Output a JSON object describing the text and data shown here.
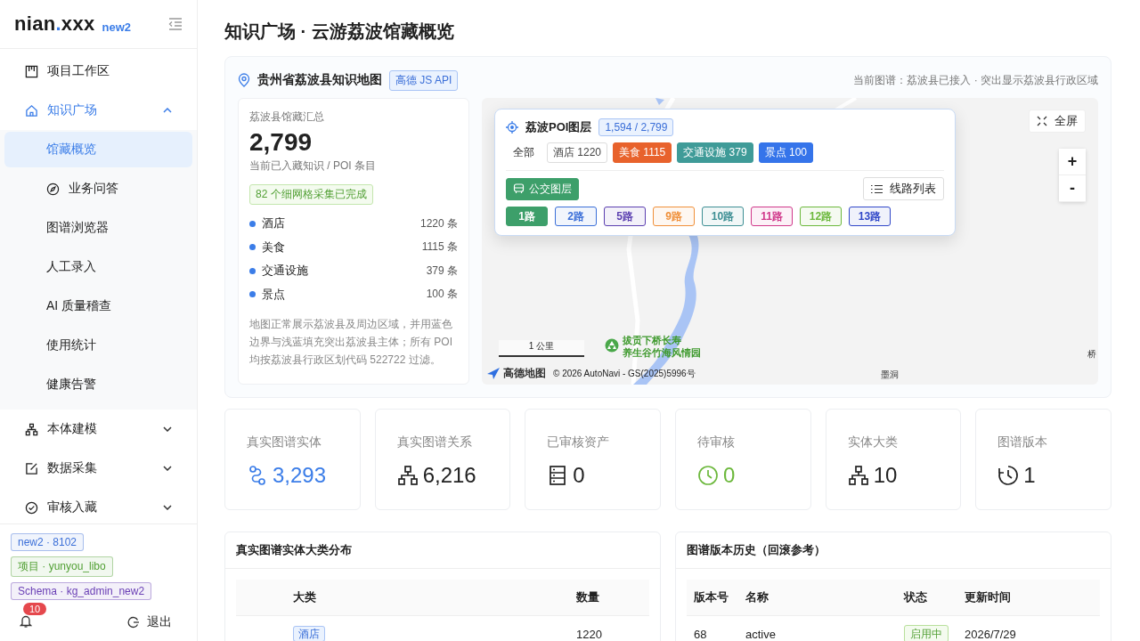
{
  "sidebar": {
    "logo": {
      "name": "nian",
      "dot": ".",
      "suffix": "xxx",
      "badge": "new2"
    },
    "nav": [
      {
        "label": "项目工作区",
        "kind": "item"
      },
      {
        "label": "知识广场",
        "kind": "group",
        "expanded": true,
        "selected": true,
        "children": [
          {
            "label": "馆藏概览",
            "selected": true
          },
          {
            "label": "业务问答",
            "selected": false
          },
          {
            "label": "图谱浏览器",
            "selected": false
          },
          {
            "label": "人工录入",
            "selected": false
          },
          {
            "label": "AI 质量稽查",
            "selected": false
          },
          {
            "label": "使用统计",
            "selected": false
          },
          {
            "label": "健康告警",
            "selected": false
          }
        ]
      },
      {
        "label": "本体建模",
        "kind": "group",
        "expanded": false,
        "selected": false
      },
      {
        "label": "数据采集",
        "kind": "group",
        "expanded": false,
        "selected": false
      },
      {
        "label": "审核入藏",
        "kind": "group",
        "expanded": false,
        "selected": false
      }
    ],
    "tags": [
      {
        "label": "new2 · 8102",
        "color": "#3b6fd8"
      },
      {
        "label": "项目 · yunyou_libo",
        "color": "#52a035"
      },
      {
        "label": "Schema · kg_admin_new2",
        "color": "#6a3fb5"
      }
    ],
    "notifications": "10",
    "logout": "退出"
  },
  "page_title": "知识广场 · 云游荔波馆藏概览",
  "map_panel": {
    "title": "贵州省荔波县知识地图",
    "tag": "高德 JS API",
    "note": "当前图谱：荔波县已接入 · 突出显示荔波县行政区域",
    "summary": {
      "label": "荔波县馆藏汇总",
      "total": "2,799",
      "caption": "当前已入藏知识 / POI 条目",
      "badge": "82 个细网格采集已完成",
      "categories": [
        {
          "name": "酒店",
          "count": "1220 条"
        },
        {
          "name": "美食",
          "count": "1115 条"
        },
        {
          "name": "交通设施",
          "count": "379 条"
        },
        {
          "name": "景点",
          "count": "100 条"
        }
      ],
      "description": "地图正常展示荔波县及周边区域，并用蓝色边界与浅蓝填充突出荔波县主体；所有 POI 均按荔波县行政区划代码 522722 过滤。"
    },
    "map": {
      "poi_layer": {
        "title": "荔波POI图层",
        "count": "1,594 / 2,799",
        "all_label": "全部",
        "filters": [
          {
            "label": "酒店 1220",
            "on": false
          },
          {
            "label": "美食 1115",
            "on": true,
            "color": "#e8622c"
          },
          {
            "label": "交通设施 379",
            "on": true,
            "color": "#3f9b98"
          },
          {
            "label": "景点 100",
            "on": true,
            "color": "#3574ea"
          }
        ]
      },
      "bus_layer": {
        "label": "公交图层",
        "on": true,
        "list_button": "线路列表",
        "routes": [
          {
            "label": "1路",
            "selected": true,
            "color": "#3d9f6a"
          },
          {
            "label": "2路",
            "selected": false,
            "color": "#3b6fd8"
          },
          {
            "label": "5路",
            "selected": false,
            "color": "#5b3fb0"
          },
          {
            "label": "9路",
            "selected": false,
            "color": "#f0903a"
          },
          {
            "label": "10路",
            "selected": false,
            "color": "#3d8f94"
          },
          {
            "label": "11路",
            "selected": false,
            "color": "#d0388a"
          },
          {
            "label": "12路",
            "selected": false,
            "color": "#6cb83c"
          },
          {
            "label": "13路",
            "selected": false,
            "color": "#3047c8"
          }
        ]
      },
      "fullscreen": "全屏",
      "zoom_in": "+",
      "zoom_out": "-",
      "scale": "1 公里",
      "poi_label": [
        "拔贡下桥长寿",
        "养生谷竹海风情园"
      ],
      "place_labels": [
        "墨洞",
        "桥"
      ],
      "brand": "高德地图",
      "attribution": "© 2026 AutoNavi - GS(2025)5996号"
    }
  },
  "stats": [
    {
      "label": "真实图谱实体",
      "value": "3,293",
      "color": "#3b7de8"
    },
    {
      "label": "真实图谱关系",
      "value": "6,216",
      "color": "#222222"
    },
    {
      "label": "已审核资产",
      "value": "0",
      "color": "#222222"
    },
    {
      "label": "待审核",
      "value": "0",
      "color": "#6cb83c"
    },
    {
      "label": "实体大类",
      "value": "10",
      "color": "#222222"
    },
    {
      "label": "图谱版本",
      "value": "1",
      "color": "#222222"
    }
  ],
  "entity_panel": {
    "title": "真实图谱实体大类分布",
    "columns": [
      "大类",
      "数量"
    ],
    "rows": [
      {
        "category": "酒店",
        "count": "1220"
      }
    ]
  },
  "version_panel": {
    "title": "图谱版本历史（回滚参考）",
    "columns": [
      "版本号",
      "名称",
      "状态",
      "更新时间"
    ],
    "rows": [
      {
        "version": "68",
        "name": "active",
        "status": "启用中",
        "active": true,
        "time": "2026/7/29"
      }
    ]
  }
}
